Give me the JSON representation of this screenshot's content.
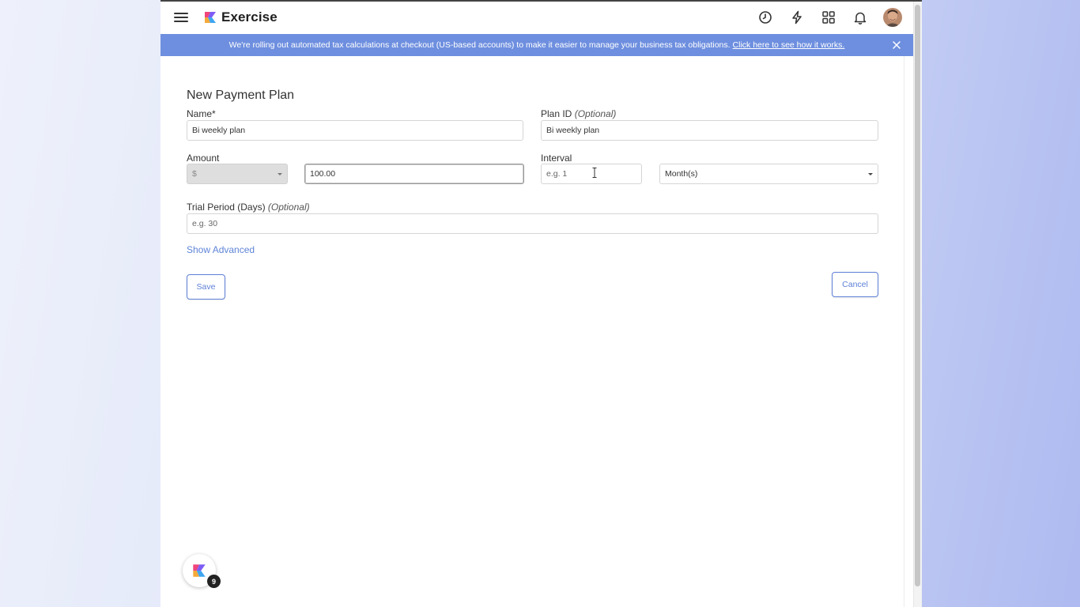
{
  "app": {
    "title": "Exercise"
  },
  "topbar": {
    "icons": [
      "menu-icon",
      "clock-icon",
      "lightning-icon",
      "apps-grid-icon",
      "bell-icon",
      "avatar"
    ]
  },
  "banner": {
    "text": "We're rolling out automated tax calculations at checkout (US-based accounts) to make it easier to manage your business tax obligations.",
    "link_text": "Click here to see how it works.",
    "background": "#6e8fdf"
  },
  "form": {
    "title": "New Payment Plan",
    "name": {
      "label": "Name*",
      "value": "Bi weekly plan"
    },
    "plan_id": {
      "label": "Plan ID",
      "optional": "(Optional)",
      "value": "Bi weekly plan"
    },
    "amount": {
      "label": "Amount",
      "currency": "$",
      "value": "100.00"
    },
    "interval": {
      "label": "Interval",
      "placeholder": "e.g. 1",
      "unit": "Month(s)"
    },
    "trial": {
      "label": "Trial Period (Days)",
      "optional": "(Optional)",
      "placeholder": "e.g. 30"
    },
    "show_advanced": "Show Advanced",
    "save_label": "Save",
    "cancel_label": "Cancel"
  },
  "fab": {
    "badge": "9"
  },
  "colors": {
    "accent": "#5d7fd6",
    "link": "#5f85d8"
  }
}
